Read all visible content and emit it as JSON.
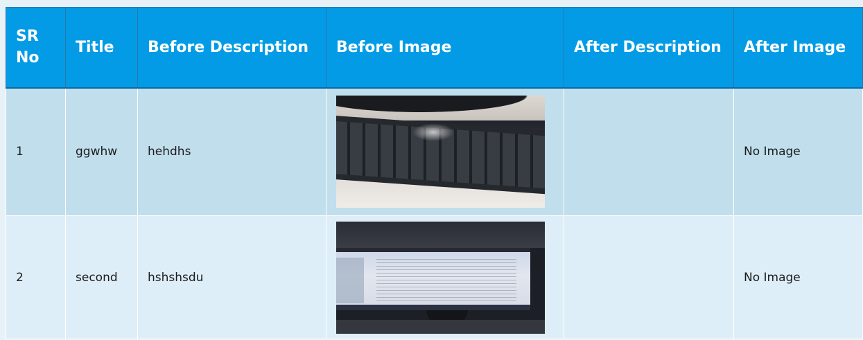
{
  "table": {
    "headers": {
      "sr_no": "SR No",
      "title": "Title",
      "before_description": "Before Description",
      "before_image": "Before Image",
      "after_description": "After Description",
      "after_image": "After Image"
    },
    "rows": [
      {
        "sr_no": "1",
        "title": "ggwhw",
        "before_description": "hehdhs",
        "before_image": "keyboard-photo",
        "after_description": "",
        "after_image": "No Image"
      },
      {
        "sr_no": "2",
        "title": "second",
        "before_description": "hshshsdu",
        "before_image": "monitor-photo",
        "after_description": "",
        "after_image": "No Image"
      }
    ]
  },
  "colors": {
    "header_bg": "#039be5",
    "header_text": "#ffffff",
    "row_1_bg": "#c1deec",
    "row_2_bg": "#deeef8",
    "page_bg": "#e6f1f8"
  }
}
